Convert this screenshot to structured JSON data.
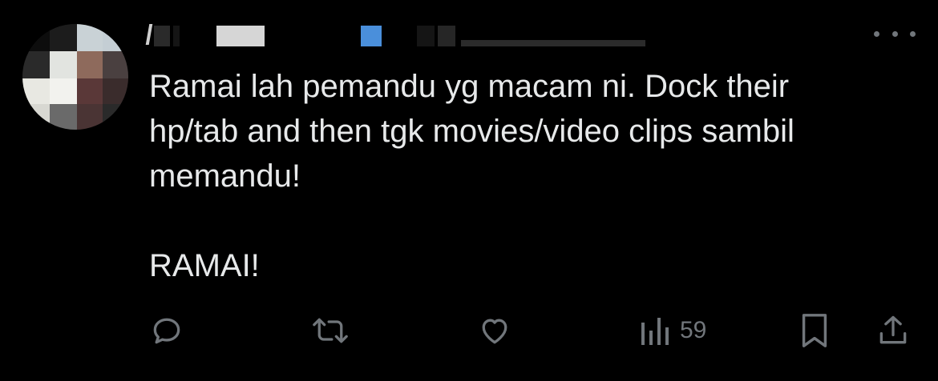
{
  "tweet": {
    "text": "Ramai lah pemandu yg macam ni. Dock their\nhp/tab and then tgk movies/video clips sambil\nmemandu!\n\nRAMAI!"
  },
  "actions": {
    "views_count": "59"
  },
  "icons": {
    "reply": "reply-icon",
    "retweet": "retweet-icon",
    "like": "heart-icon",
    "views": "views-chart-icon",
    "bookmark": "bookmark-icon",
    "share": "share-icon",
    "more": "more-dots-icon"
  },
  "colors": {
    "background": "#000000",
    "text": "#e7e9ea",
    "muted": "#71767b"
  }
}
